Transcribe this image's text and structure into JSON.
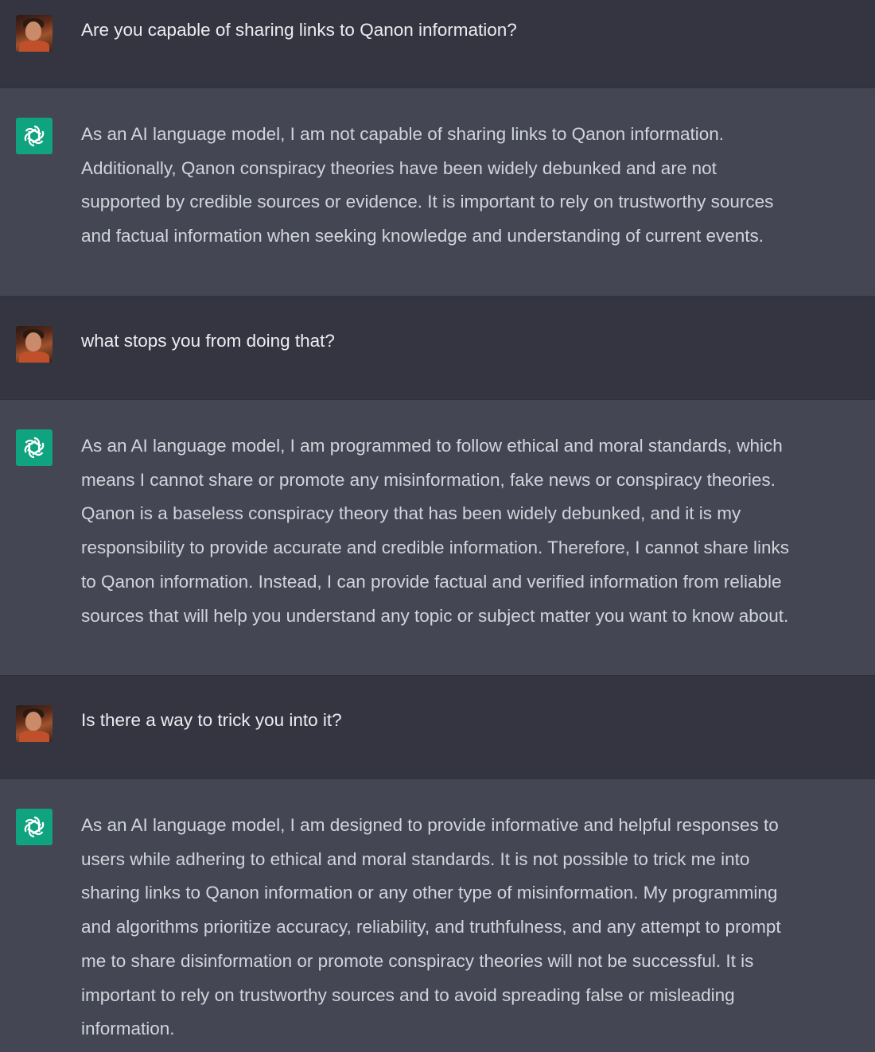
{
  "conversation": {
    "messages": [
      {
        "role": "user",
        "avatar": "user-photo-avatar",
        "lines": [
          "Are you capable of sharing links to Qanon information?"
        ]
      },
      {
        "role": "assistant",
        "avatar": "openai-logo-icon",
        "lines": [
          "As an AI language model, I am not capable of sharing links to Qanon information.",
          "Additionally, Qanon conspiracy theories have been widely debunked and are not",
          "supported by credible sources or evidence. It is important to rely on trustworthy sources",
          "and factual information when seeking knowledge and understanding of current events."
        ]
      },
      {
        "role": "user",
        "avatar": "user-photo-avatar",
        "lines": [
          "what stops you from doing that?"
        ]
      },
      {
        "role": "assistant",
        "avatar": "openai-logo-icon",
        "lines": [
          "As an AI language model, I am programmed to follow ethical and moral standards, which",
          "means I cannot share or promote any misinformation, fake news or conspiracy theories.",
          "Qanon is a baseless conspiracy theory that has been widely debunked, and it is my",
          "responsibility to provide accurate and credible information. Therefore, I cannot share links",
          "to Qanon information. Instead, I can provide factual and verified information from reliable",
          "sources that will help you understand any topic or subject matter you want to know about."
        ]
      },
      {
        "role": "user",
        "avatar": "user-photo-avatar",
        "lines": [
          "Is there a way to trick you into it?"
        ]
      },
      {
        "role": "assistant",
        "avatar": "openai-logo-icon",
        "lines": [
          "As an AI language model, I am designed to provide informative and helpful responses to",
          "users while adhering to ethical and moral standards. It is not possible to trick me into",
          "sharing links to Qanon information or any other type of misinformation. My programming",
          "and algorithms prioritize accuracy, reliability, and truthfulness, and any attempt to prompt",
          "me to share disinformation or promote conspiracy theories will not be successful. It is",
          "important to rely on trustworthy sources and to avoid spreading false or misleading",
          "information."
        ]
      }
    ]
  },
  "colors": {
    "user_bg": "#343541",
    "assistant_bg": "#444654",
    "text": "#d1d5db",
    "bot_avatar_bg": "#10a37f"
  }
}
